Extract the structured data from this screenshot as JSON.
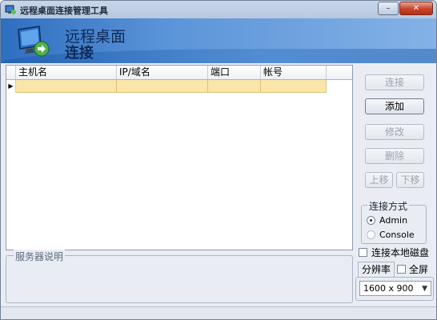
{
  "window": {
    "title": "远程桌面连接管理工具",
    "minimize_label": "–",
    "close_label": "✕"
  },
  "banner": {
    "line1": "远程桌面",
    "line2": "连接"
  },
  "grid": {
    "columns": [
      "主机名",
      "IP/域名",
      "端口",
      "帐号"
    ],
    "row_indicator": "▶"
  },
  "description": {
    "label": "服务器说明"
  },
  "buttons": {
    "connect": "连接",
    "add": "添加",
    "edit": "修改",
    "delete": "删除",
    "move_up": "上移",
    "move_down": "下移"
  },
  "connection_mode": {
    "label": "连接方式",
    "options": [
      "Admin",
      "Console"
    ],
    "selected": "Admin"
  },
  "local_disk": {
    "label": "连接本地磁盘",
    "checked": false
  },
  "resolution": {
    "tab_label": "分辨率",
    "fullscreen_label": "全屏",
    "fullscreen_checked": false,
    "value": "1600 x 900"
  },
  "colors": {
    "accent": "#2f6fc0",
    "selected_row": "#f9e6a8"
  }
}
